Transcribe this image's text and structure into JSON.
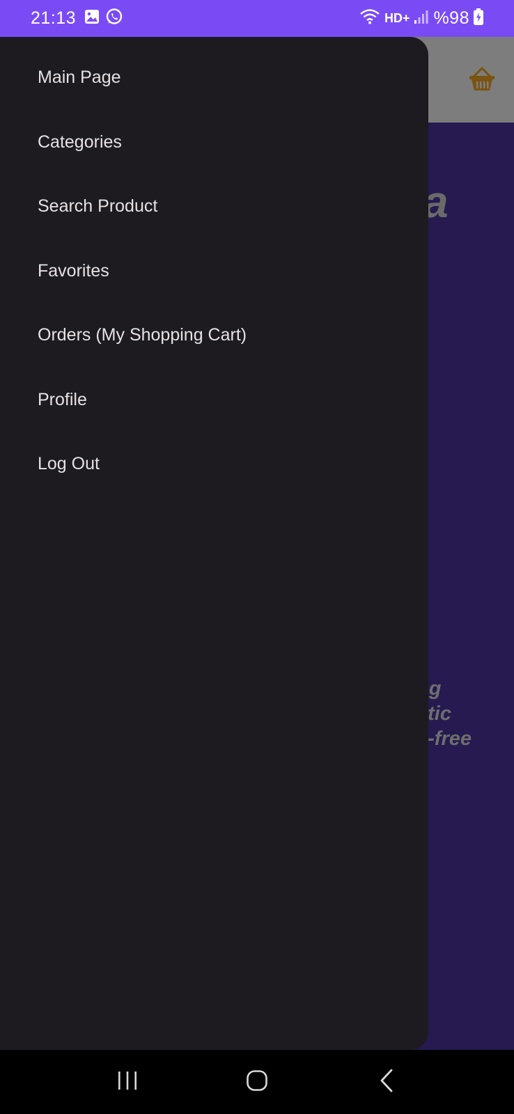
{
  "status_bar": {
    "time": "21:13",
    "battery": "%98",
    "network": "HD+",
    "background_color": "#7a4bf5"
  },
  "background_app": {
    "brand_fragment": "a",
    "description_fragment": "a\nng\natic\ny-free",
    "header_color": "#7d7d7d",
    "body_color": "#261a50"
  },
  "drawer": {
    "background_color": "#1d1b20",
    "items": [
      {
        "label": "Main Page"
      },
      {
        "label": "Categories"
      },
      {
        "label": "Search Product"
      },
      {
        "label": "Favorites"
      },
      {
        "label": "Orders (My Shopping Cart)"
      },
      {
        "label": "Profile"
      },
      {
        "label": "Log Out"
      }
    ]
  },
  "icons": {
    "gallery": "gallery-icon",
    "whatsapp": "whatsapp-icon",
    "wifi": "wifi-icon",
    "signal": "signal-icon",
    "battery": "battery-charging-icon",
    "basket": "basket-icon",
    "cart": "cart-icon",
    "nav_recents": "recents-icon",
    "nav_home": "home-icon",
    "nav_back": "back-icon"
  }
}
